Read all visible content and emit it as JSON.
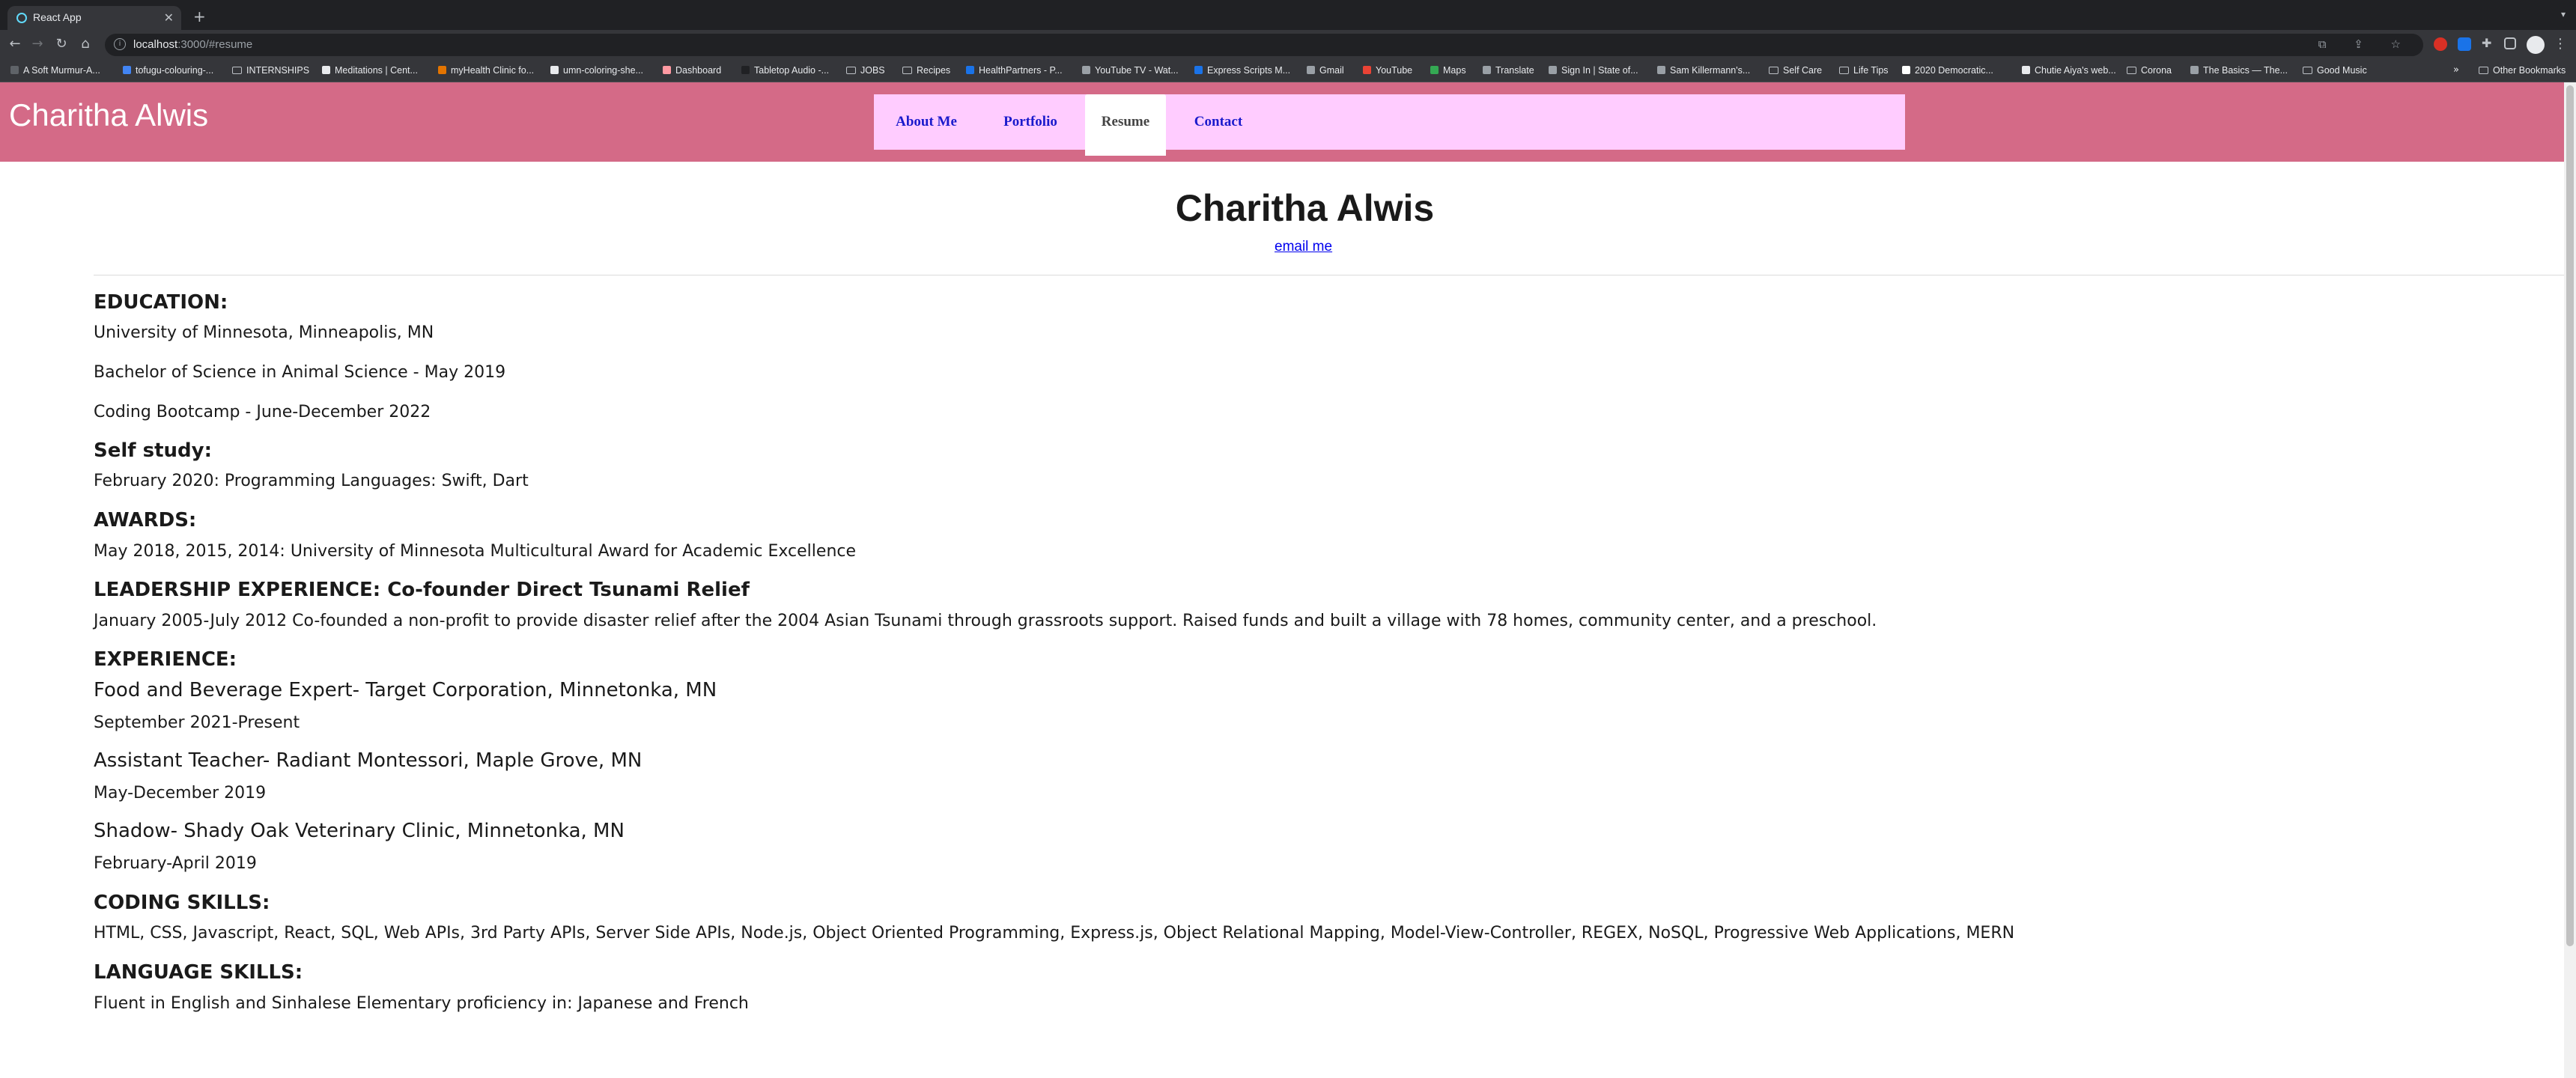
{
  "browser": {
    "tab_title": "React App",
    "url_host": "localhost",
    "url_rest": ":3000/#resume",
    "bookmarks": [
      "A Soft Murmur-A...",
      "tofugu-colouring-...",
      "INTERNSHIPS",
      "Meditations | Cent...",
      "myHealth Clinic fo...",
      "umn-coloring-she...",
      "Dashboard",
      "Tabletop Audio -...",
      "JOBS",
      "Recipes",
      "HealthPartners - P...",
      "YouTube TV - Wat...",
      "Express Scripts M...",
      "Gmail",
      "YouTube",
      "Maps",
      "Translate",
      "Sign In | State of...",
      "Sam Killermann's...",
      "Self Care",
      "Life Tips",
      "2020 Democratic...",
      "Chutie Aiya's web...",
      "Corona",
      "The Basics — The...",
      "Good Music"
    ],
    "other_bookmarks": "Other Bookmarks"
  },
  "site": {
    "brand": "Charitha Alwis",
    "nav": [
      "About Me",
      "Portfolio",
      "Resume",
      "Contact"
    ],
    "active_nav": "Resume"
  },
  "resume": {
    "name": "Charitha Alwis",
    "email_link": "email me",
    "education_heading": "EDUCATION:",
    "education": [
      "University of Minnesota, Minneapolis, MN",
      "Bachelor of Science in Animal Science - May 2019",
      "Coding Bootcamp - June-December 2022"
    ],
    "self_study_heading": "Self study:",
    "self_study": "February 2020: Programming Languages: Swift, Dart",
    "awards_heading": "AWARDS:",
    "awards": "May 2018, 2015, 2014: University of Minnesota Multicultural Award for Academic Excellence",
    "leadership_heading": "LEADERSHIP EXPERIENCE: Co-founder Direct Tsunami Relief",
    "leadership": "January 2005-July 2012 Co-founded a non-profit to provide disaster relief after the 2004 Asian Tsunami through grassroots support. Raised funds and built a village with 78 homes, community center, and a preschool.",
    "experience_heading": "EXPERIENCE:",
    "experience": [
      {
        "title": "Food and Beverage Expert- Target Corporation, Minnetonka, MN",
        "dates": "September 2021-Present"
      },
      {
        "title": "Assistant Teacher- Radiant Montessori, Maple Grove, MN",
        "dates": "May-December 2019"
      },
      {
        "title": "Shadow- Shady Oak Veterinary Clinic, Minnetonka, MN",
        "dates": "February-April 2019"
      }
    ],
    "coding_heading": "CODING SKILLS:",
    "coding": "HTML, CSS, Javascript, React, SQL, Web APIs, 3rd Party APIs, Server Side APIs, Node.js, Object Oriented Programming, Express.js, Object Relational Mapping, Model-View-Controller, REGEX, NoSQL, Progressive Web Applications, MERN",
    "language_heading": "LANGUAGE SKILLS:",
    "language": "Fluent in English and Sinhalese Elementary proficiency in: Japanese and French"
  }
}
